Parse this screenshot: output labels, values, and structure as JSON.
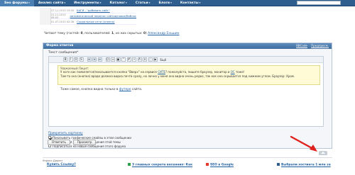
{
  "nav": {
    "items": [
      {
        "label": "Seo форумы",
        "arrow": "▾"
      },
      {
        "label": "Анализ сайта",
        "arrow": "▾"
      },
      {
        "label": "Инструменты",
        "arrow": "▾"
      },
      {
        "label": "Каталог",
        "arrow": "▾"
      },
      {
        "label": "Статьи",
        "arrow": "▾"
      },
      {
        "label": "Блоги",
        "arrow": "▾"
      },
      {
        "label": "Контакты",
        "arrow": "▾"
      }
    ],
    "search_placeholder": ""
  },
  "recent_posts": [
    {
      "date": "27.11.2013 15:00",
      "title": "БАГИ - \"добавить сайт\""
    },
    {
      "date": "21.11.2013 08:00",
      "title": "автоматический перенос сайтов/новое/баблос"
    },
    {
      "date": "01.07.2013 02:36",
      "title": "Социальные сети (кнопка)"
    }
  ],
  "readers": {
    "prefix": "Читают тему (гостей: ",
    "guests": "0",
    "mid": ", пользователей: ",
    "users": "1",
    "mid2": ", из них скрытых: ",
    "hidden": "0",
    "suffix": ") ",
    "user_link": "Александр Еньшин"
  },
  "reply_form": {
    "title": "Форма ответов",
    "mode_bbcode": "BBCode",
    "mode_preview": "Предпросм.",
    "message_label": "Текст сообщения*",
    "toolbar_more": "Ещё",
    "quote": {
      "author": "Уважаемый Лицит:",
      "line1_a": "У кого как появляется/показывается кнопка \"Вверх\" на сервисе ",
      "line1_link": "СИТЕ",
      "line1_b": "? пожалуйста, пишите браузер, монитор и ",
      "line1_link2": "ОС",
      "line1_c": " тоже!",
      "line2": "Там-то она (кнопка) вроде должна видна почти сразу, но лично у меня она видна очень редко, так как она скрывается под нижним углом. Браузер: Хром."
    },
    "answer_prefix": "Тоже самое, кнопка видна только в ",
    "answer_link": "футере",
    "answer_suffix": " сайта.",
    "attach_label": "Прикрепить картинку",
    "options": [
      {
        "label": "Показывать графические смайлы в этом сообщении",
        "checked": true
      },
      {
        "label": "Подписаться на новые сообщения этой темы",
        "checked": false
      },
      {
        "label": "Подписаться на новые сообщения этого форума",
        "checked": false
      }
    ],
    "submit_label": "Ответить",
    "preview_label": "Просмотр"
  },
  "ads": {
    "label": "Яндекс.Директ",
    "items": [
      {
        "title": "Купить Ссылку?",
        "icon_color": "#ffffff"
      },
      {
        "title": "3 главных секрета весенних: Как",
        "icon_color": "#2aa14a"
      },
      {
        "title": "SEO в Google",
        "icon_color": "#e43b2f"
      },
      {
        "title": "Выбрали хостинга 1 млн за",
        "icon_color": "#2d5e8e"
      }
    ]
  },
  "colors": {
    "nav_bg": "#2d5e8e",
    "link": "#1f5fa3",
    "annotation_arrow": "#e0201d",
    "quote_bg": "#fffbd6"
  },
  "icons": [
    "scroll-to-top-icon",
    "bold-icon",
    "italic-icon",
    "underline-icon",
    "strike-icon",
    "smile-icon",
    "link-icon",
    "image-icon",
    "quote-icon",
    "code-icon",
    "list-icon"
  ]
}
